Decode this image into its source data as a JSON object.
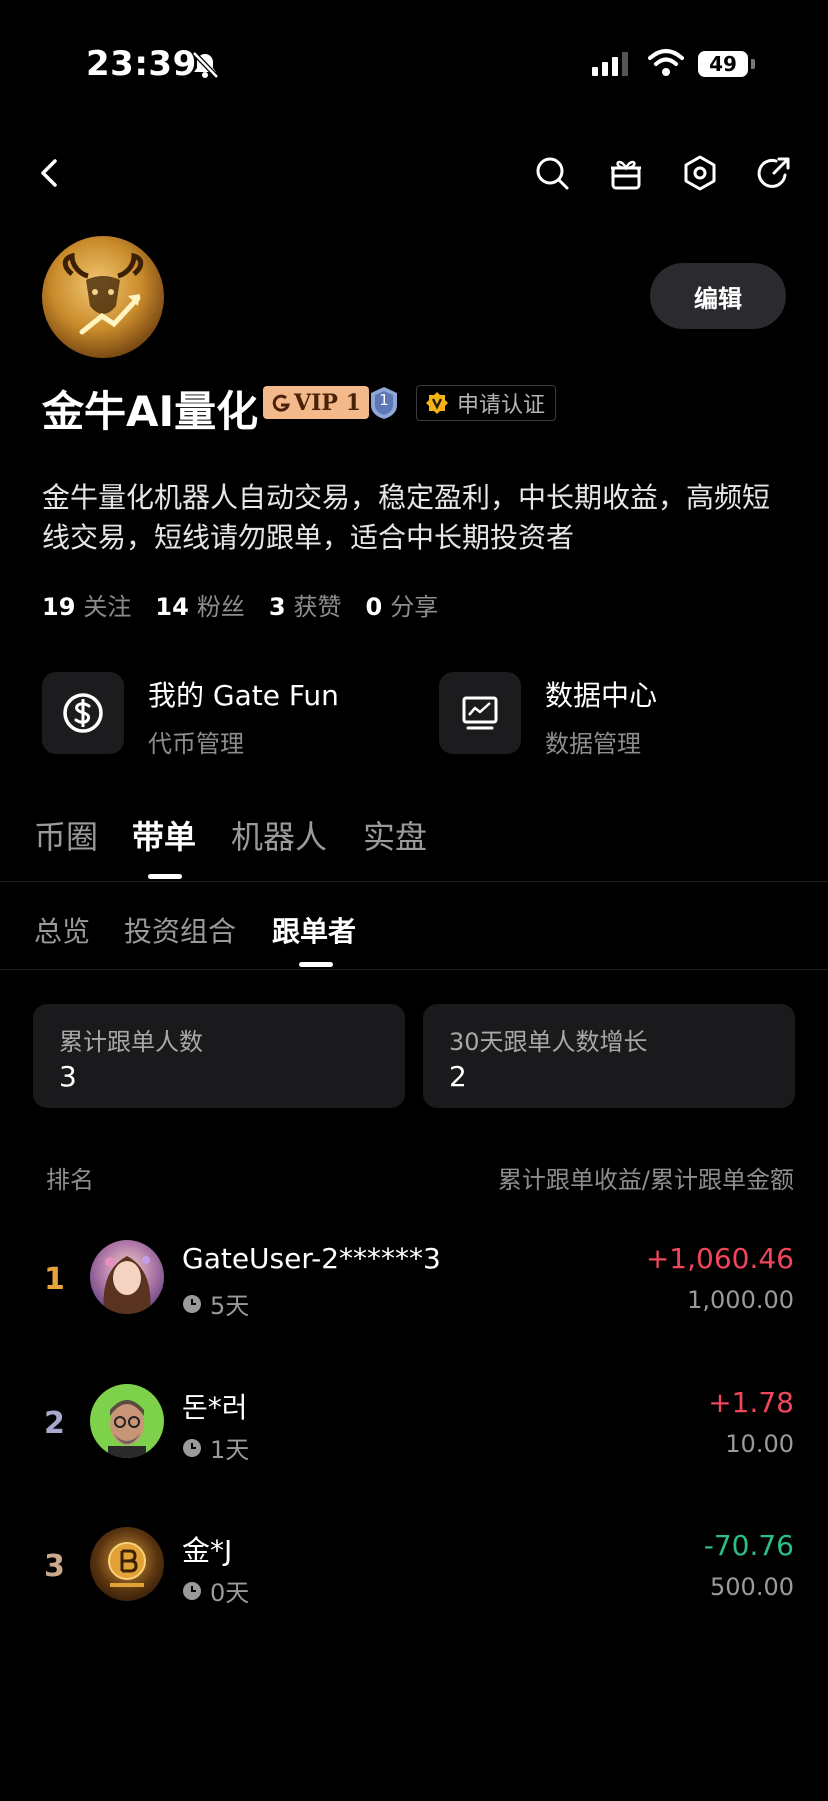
{
  "status": {
    "time": "23:39",
    "battery": "49"
  },
  "profile": {
    "name": "金牛AI量化",
    "vip": "VIP 1",
    "level": "1",
    "verify_label": "申请认证",
    "edit_label": "编辑",
    "bio": "金牛量化机器人自动交易，稳定盈利，中长期收益，高频短线交易，短线请勿跟单，适合中长期投资者",
    "stats": [
      {
        "num": "19",
        "label": "关注"
      },
      {
        "num": "14",
        "label": "粉丝"
      },
      {
        "num": "3",
        "label": "获赞"
      },
      {
        "num": "0",
        "label": "分享"
      }
    ]
  },
  "cards": [
    {
      "title": "我的 Gate Fun",
      "sub": "代币管理",
      "icon": "dollar-circle-icon"
    },
    {
      "title": "数据中心",
      "sub": "数据管理",
      "icon": "chart-monitor-icon"
    }
  ],
  "main_tabs": [
    "币圈",
    "带单",
    "机器人",
    "实盘"
  ],
  "main_tab_active": "带单",
  "sub_tabs": [
    "总览",
    "投资组合",
    "跟单者"
  ],
  "sub_tab_active": "跟单者",
  "summary": [
    {
      "label": "累计跟单人数",
      "value": "3"
    },
    {
      "label": "30天跟单人数增长",
      "value": "2"
    }
  ],
  "list_header": {
    "left": "排名",
    "right": "累计跟单收益/累计跟单金额"
  },
  "followers": [
    {
      "rank": "1",
      "name": "GateUser-2******3",
      "days": "5天",
      "profit": "+1,060.46",
      "amount": "1,000.00"
    },
    {
      "rank": "2",
      "name": "돈*러",
      "days": "1天",
      "profit": "+1.78",
      "amount": "10.00"
    },
    {
      "rank": "3",
      "name": "金*J",
      "days": "0天",
      "profit": "-70.76",
      "amount": "500.00"
    }
  ],
  "colors": {
    "rank1": "#e7a43a",
    "rank2": "#a8a8cf",
    "rank3": "#c8a98a",
    "positive": "#f0465b",
    "negative": "#2dbd85",
    "vip_bg": "#f3b98b"
  }
}
